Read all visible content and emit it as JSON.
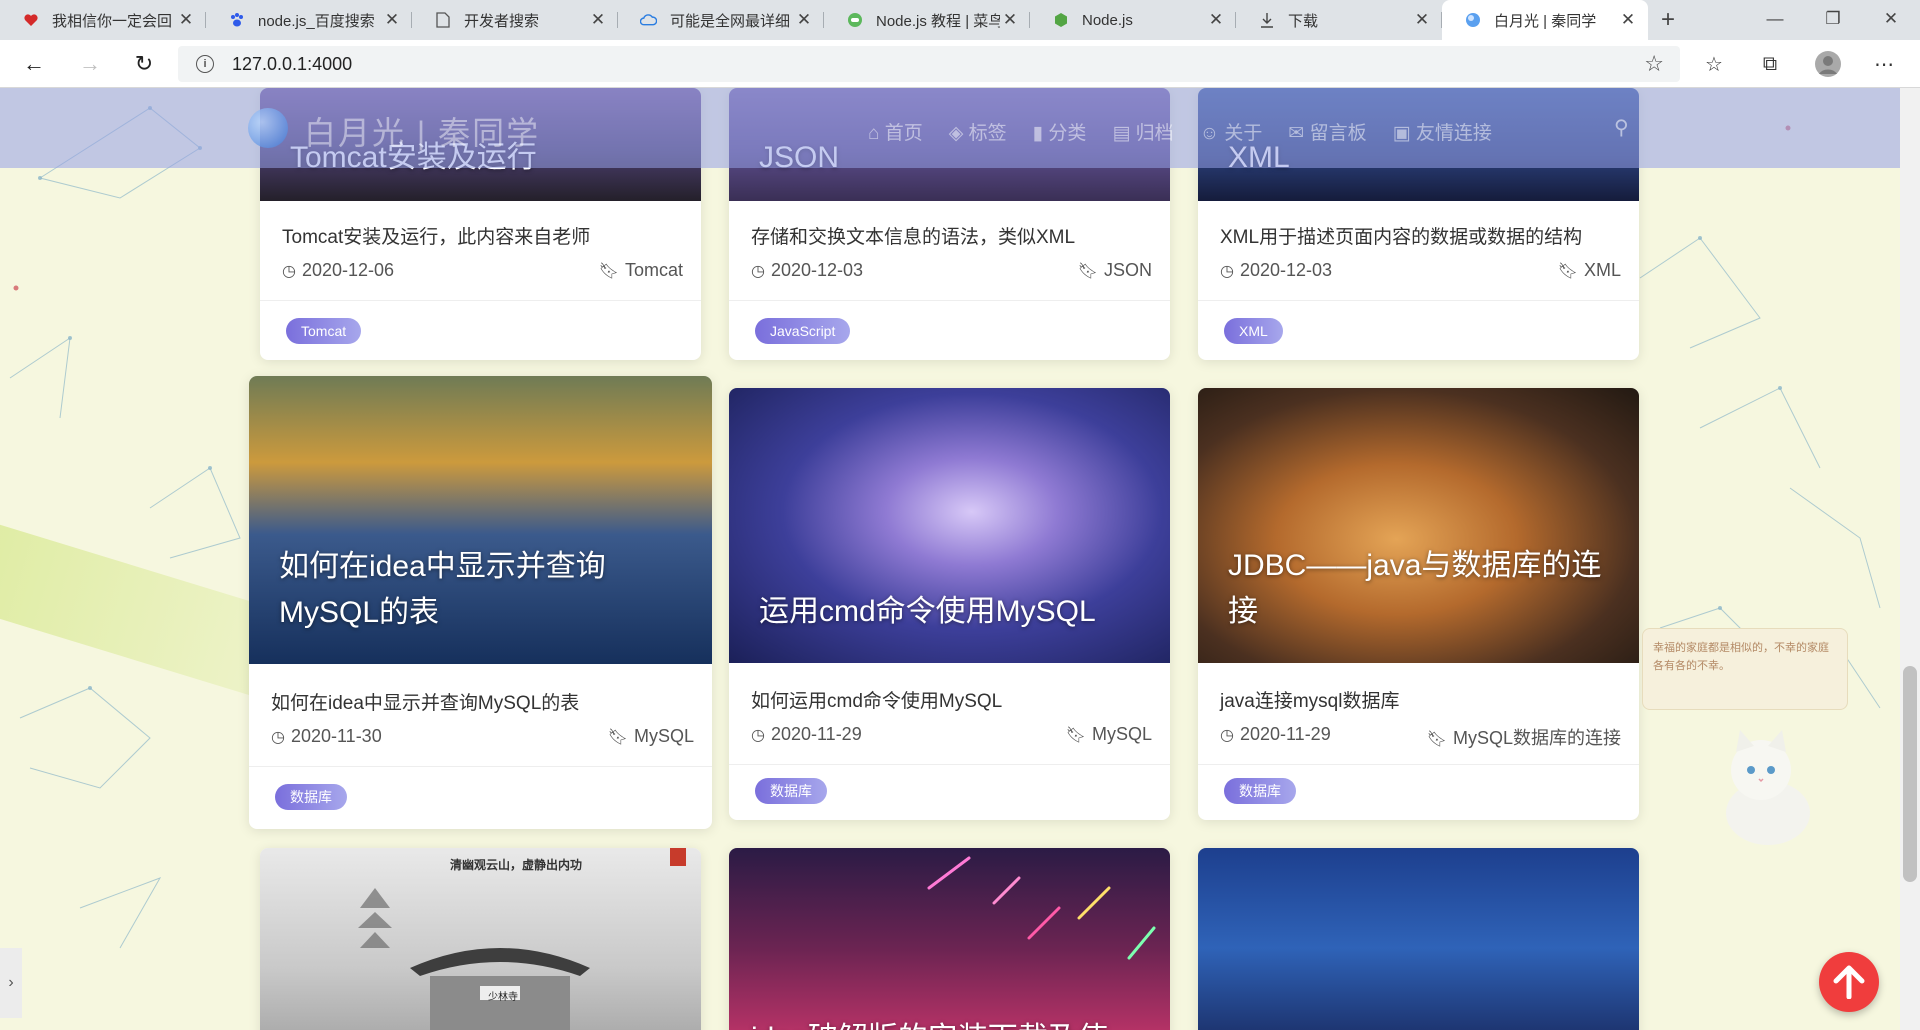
{
  "browser": {
    "tabs": [
      {
        "title": "我相信你一定会回",
        "icon": "heart-icon",
        "active": false
      },
      {
        "title": "node.js_百度搜索",
        "icon": "baidu-paw-icon",
        "active": false
      },
      {
        "title": "开发者搜索",
        "icon": "document-icon",
        "active": false
      },
      {
        "title": "可能是全网最详细",
        "icon": "cloud-icon",
        "active": false
      },
      {
        "title": "Node.js 教程 | 菜鸟",
        "icon": "runoob-icon",
        "active": false
      },
      {
        "title": "Node.js",
        "icon": "nodejs-hexagon-icon",
        "active": false
      },
      {
        "title": "下载",
        "icon": "download-icon",
        "active": false
      },
      {
        "title": "白月光 | 秦同学",
        "icon": "site-logo-icon",
        "active": true
      }
    ],
    "url": "127.0.0.1:4000"
  },
  "site": {
    "title": "白月光 | 秦同学",
    "menu": [
      "首页",
      "标签",
      "分类",
      "归档",
      "关于",
      "留言板",
      "友情连接"
    ]
  },
  "posts": {
    "tomcat": {
      "cover_title": "Tomcat安装及运行",
      "summary": "Tomcat安装及运行，此内容来自老师",
      "date": "2020-12-06",
      "category": "Tomcat",
      "tag": "Tomcat"
    },
    "json": {
      "cover_title": "JSON",
      "summary": "存储和交换文本信息的语法，类似XML",
      "date": "2020-12-03",
      "category": "JSON",
      "tag": "JavaScript"
    },
    "xml": {
      "cover_title": "XML",
      "summary": "XML用于描述页面内容的数据或数据的结构",
      "date": "2020-12-03",
      "category": "XML",
      "tag": "XML"
    },
    "idea": {
      "cover_title": "如何在idea中显示并查询MySQL的表",
      "summary": "如何在idea中显示并查询MySQL的表",
      "date": "2020-11-30",
      "category": "MySQL",
      "tag": "数据库"
    },
    "cmd": {
      "cover_title": "运用cmd命令使用MySQL",
      "summary": "如何运用cmd命令使用MySQL",
      "date": "2020-11-29",
      "category": "MySQL",
      "tag": "数据库"
    },
    "jdbc": {
      "cover_title": "JDBC——java与数据库的连接",
      "summary": "java连接mysql数据库",
      "date": "2020-11-29",
      "category": "MySQL数据库的连接",
      "tag": "数据库"
    },
    "shaolin": {
      "cover_text": "清幽观云山，虚静出内功",
      "sign_text": "少林寺"
    },
    "meteor": {
      "cover_title": "idea破解版的安装下载及使"
    },
    "galaxy": {}
  },
  "widget": {
    "quote": "幸福的家庭都是相似的，不幸的家庭各有各的不幸。"
  },
  "colors": {
    "accent": "#7a6fdc",
    "backtop": "#f03d3d"
  }
}
